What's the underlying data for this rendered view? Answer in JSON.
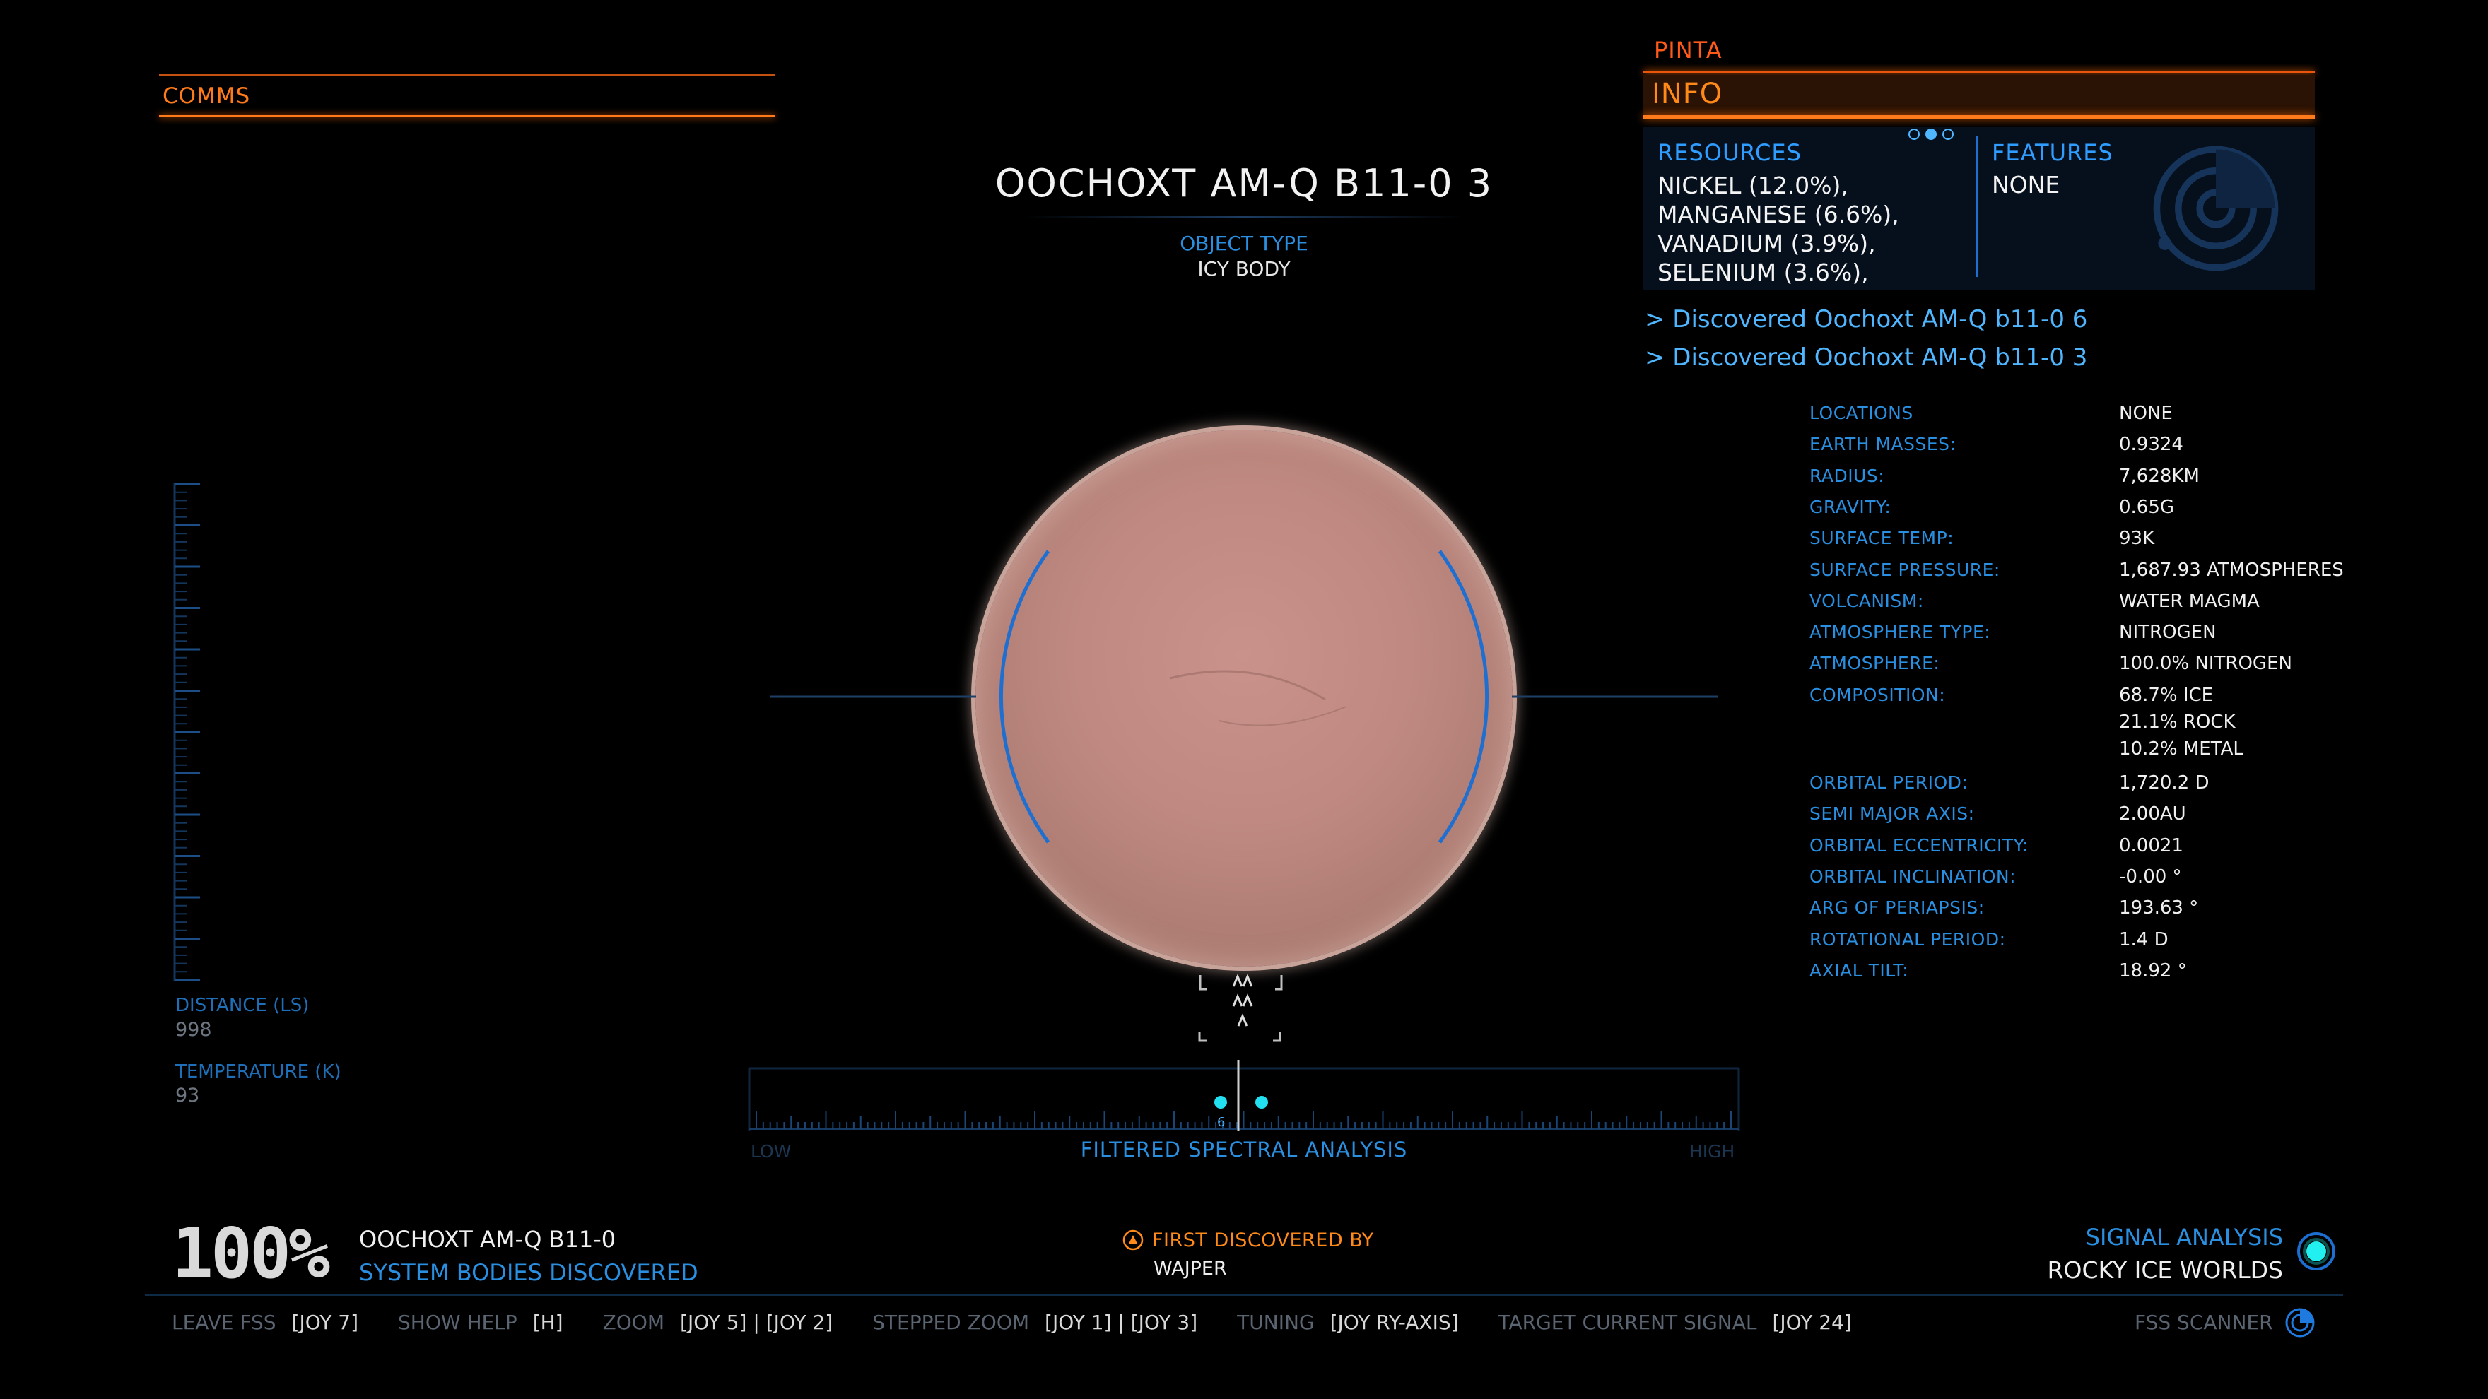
{
  "comms": {
    "label": "COMMS"
  },
  "body": {
    "title": "OOCHOXT AM-Q B11-0 3",
    "object_type_label": "OBJECT TYPE",
    "object_type_value": "ICY BODY"
  },
  "info_panel": {
    "ship": "PINTA",
    "header": "INFO",
    "page_dots": 3,
    "resources_label": "RESOURCES",
    "resources": [
      "NICKEL (12.0%),",
      "MANGANESE (6.6%),",
      "VANADIUM (3.9%),",
      "SELENIUM (3.6%),"
    ],
    "features_label": "FEATURES",
    "features_value": "NONE",
    "discoveries": [
      "> Discovered Oochoxt AM-Q b11-0 6",
      "> Discovered Oochoxt AM-Q b11-0 3"
    ]
  },
  "stats": [
    {
      "k": "LOCATIONS",
      "v": [
        "NONE"
      ]
    },
    {
      "k": "EARTH MASSES:",
      "v": [
        "0.9324"
      ]
    },
    {
      "k": "RADIUS:",
      "v": [
        "7,628KM"
      ]
    },
    {
      "k": "GRAVITY:",
      "v": [
        "0.65G"
      ]
    },
    {
      "k": "SURFACE TEMP:",
      "v": [
        "93K"
      ]
    },
    {
      "k": "SURFACE PRESSURE:",
      "v": [
        "1,687.93 ATMOSPHERES"
      ]
    },
    {
      "k": "VOLCANISM:",
      "v": [
        "WATER MAGMA"
      ]
    },
    {
      "k": "ATMOSPHERE TYPE:",
      "v": [
        "NITROGEN"
      ]
    },
    {
      "k": "ATMOSPHERE:",
      "v": [
        "100.0% NITROGEN"
      ]
    },
    {
      "k": "COMPOSITION:",
      "v": [
        "68.7% ICE",
        "21.1% ROCK",
        "10.2% METAL"
      ]
    },
    {
      "k": "ORBITAL PERIOD:",
      "v": [
        "1,720.2 D"
      ]
    },
    {
      "k": "SEMI MAJOR AXIS:",
      "v": [
        "2.00AU"
      ]
    },
    {
      "k": "ORBITAL ECCENTRICITY:",
      "v": [
        "0.0021"
      ]
    },
    {
      "k": "ORBITAL INCLINATION:",
      "v": [
        "-0.00 °"
      ]
    },
    {
      "k": "ARG OF PERIAPSIS:",
      "v": [
        "193.63 °"
      ]
    },
    {
      "k": "ROTATIONAL PERIOD:",
      "v": [
        "1.4 D"
      ]
    },
    {
      "k": "AXIAL TILT:",
      "v": [
        "18.92 °"
      ]
    }
  ],
  "left_readouts": {
    "distance_label": "DISTANCE (LS)",
    "distance_value": "998",
    "temperature_label": "TEMPERATURE (K)",
    "temperature_value": "93"
  },
  "spectral": {
    "label": "FILTERED SPECTRAL ANALYSIS",
    "low": "LOW",
    "high": "HIGH",
    "signal_count": "6"
  },
  "progress": {
    "percent": "100%",
    "system": "OOCHOXT AM-Q B11-0",
    "caption": "SYSTEM BODIES DISCOVERED"
  },
  "first_discovered": {
    "label": "FIRST DISCOVERED BY",
    "value": "WAJPER"
  },
  "signal": {
    "label": "SIGNAL ANALYSIS",
    "value": "ROCKY ICE WORLDS"
  },
  "hints": [
    {
      "k": "LEAVE FSS",
      "v": "[JOY 7]"
    },
    {
      "k": "SHOW HELP",
      "v": "[H]"
    },
    {
      "k": "ZOOM",
      "v": "[JOY 5] | [JOY 2]"
    },
    {
      "k": "STEPPED ZOOM",
      "v": "[JOY 1] | [JOY 3]"
    },
    {
      "k": "TUNING",
      "v": "[JOY RY-AXIS]"
    },
    {
      "k": "TARGET CURRENT SIGNAL",
      "v": "[JOY 24]"
    }
  ],
  "fss_label": "FSS SCANNER",
  "colors": {
    "orange": "#ff7a1a",
    "blue": "#2a8fe0",
    "light_blue": "#4fb6ff",
    "cyan": "#22e0f0"
  },
  "icons": [
    "feature-radar-icon",
    "first-discovered-icon",
    "signal-analysis-icon",
    "fss-scanner-icon"
  ]
}
